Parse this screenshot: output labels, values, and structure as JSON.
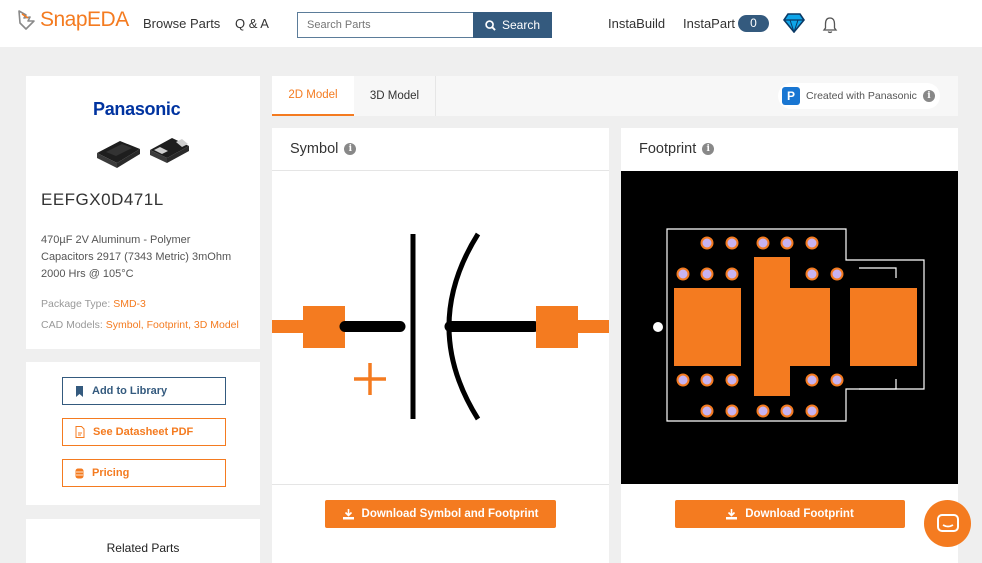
{
  "header": {
    "logo_text": "SnapEDA",
    "nav": [
      "Browse Parts",
      "Q & A"
    ],
    "search_placeholder": "Search Parts",
    "search_button": "Search",
    "instabuild": "InstaBuild",
    "instapart": "InstaPart",
    "instapart_count": "0"
  },
  "part": {
    "manufacturer": "Panasonic",
    "part_number": "EEFGX0D471L",
    "description": "470µF 2V Aluminum - Polymer Capacitors 2917 (7343 Metric) 3mOhm 2000 Hrs @ 105°C",
    "package_label": "Package Type:",
    "package_value": "SMD-3",
    "cad_label": "CAD Models:",
    "cad_value": "Symbol, Footprint, 3D Model"
  },
  "actions": {
    "add_library": "Add to Library",
    "datasheet": "See Datasheet PDF",
    "pricing": "Pricing"
  },
  "related": {
    "title": "Related Parts"
  },
  "tabs": {
    "model_2d": "2D Model",
    "model_3d": "3D Model",
    "created_with": "Created with Panasonic",
    "logo_letter": "P"
  },
  "symbol_panel": {
    "title": "Symbol",
    "download": "Download Symbol and Footprint"
  },
  "footprint_panel": {
    "title": "Footprint",
    "download": "Download Footprint"
  },
  "colors": {
    "brand_orange": "#f47b20",
    "navy": "#345a7e",
    "panasonic_blue": "#0033a0"
  }
}
